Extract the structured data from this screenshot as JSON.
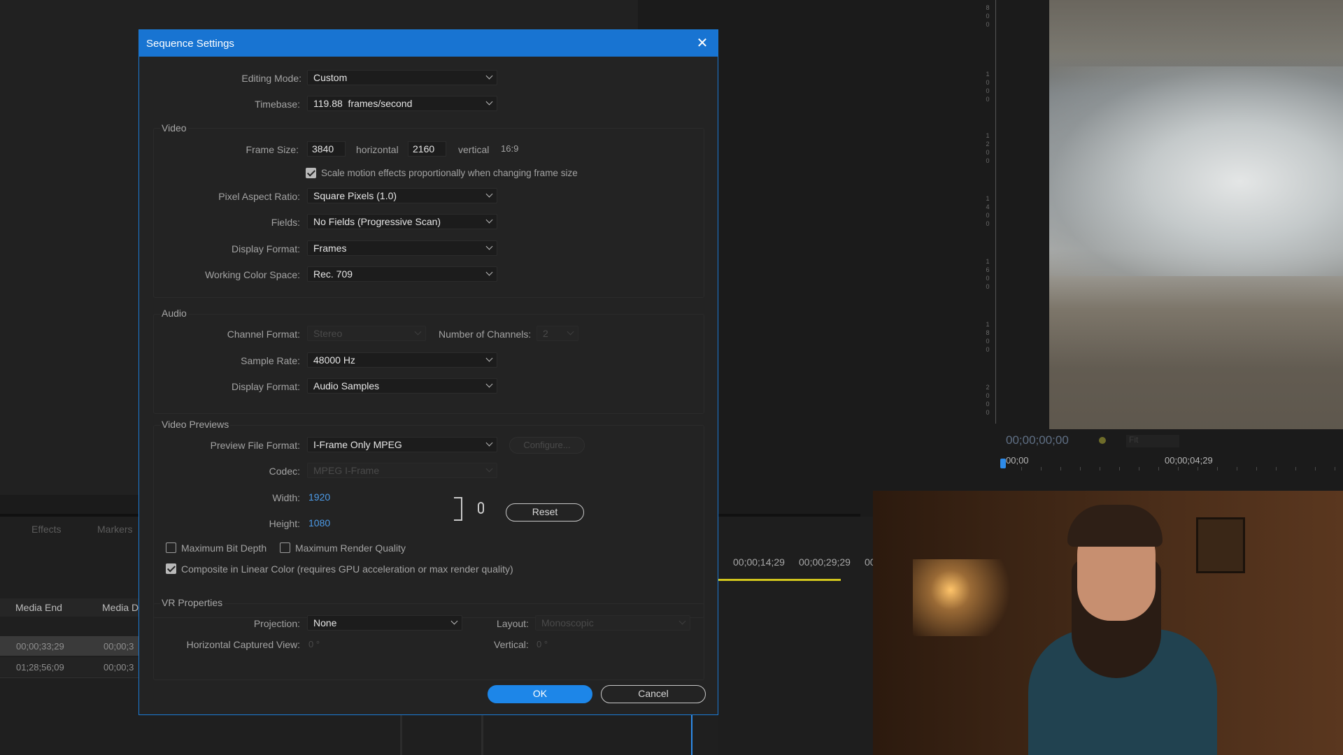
{
  "background": {
    "left_panel": {
      "tabs": [
        "Effects",
        "Markers"
      ],
      "columns": [
        "Media End",
        "Media D"
      ],
      "rows": [
        {
          "media_end": "00;00;33;29",
          "media_d": "00;00;3"
        },
        {
          "media_end": "01;28;56;09",
          "media_d": "00;00;3"
        }
      ]
    },
    "timeline": {
      "timecodes": [
        "00;00;14;29",
        "00;00;29;29",
        "00"
      ]
    },
    "program_monitor": {
      "timecode": "00;00;00;00",
      "fit_label": "Fit",
      "ruler_start": "00;00",
      "ruler_end": "00;00;04;29",
      "ruler_digits": [
        [
          "8",
          "0",
          "0"
        ],
        [
          "1",
          "0",
          "0",
          "0"
        ],
        [
          "1",
          "2",
          "0",
          "0"
        ],
        [
          "1",
          "4",
          "0",
          "0"
        ],
        [
          "1",
          "6",
          "0",
          "0"
        ],
        [
          "1",
          "8",
          "0",
          "0"
        ],
        [
          "2",
          "0",
          "0",
          "0"
        ]
      ]
    }
  },
  "dialog": {
    "title": "Sequence Settings",
    "close_icon": "close-icon",
    "editing_mode": {
      "label": "Editing Mode:",
      "value": "Custom"
    },
    "timebase": {
      "label": "Timebase:",
      "value": "119.88  frames/second"
    },
    "video": {
      "title": "Video",
      "frame_size_label": "Frame Size:",
      "width": "3840",
      "horizontal_label": "horizontal",
      "height": "2160",
      "vertical_label": "vertical",
      "aspect": "16:9",
      "scale_checkbox": {
        "label": "Scale motion effects proportionally when changing frame size",
        "checked": true
      },
      "pixel_aspect": {
        "label": "Pixel Aspect Ratio:",
        "value": "Square Pixels (1.0)"
      },
      "fields": {
        "label": "Fields:",
        "value": "No Fields (Progressive Scan)"
      },
      "display_format": {
        "label": "Display Format:",
        "value": "Frames"
      },
      "working_color_space": {
        "label": "Working Color Space:",
        "value": "Rec. 709"
      }
    },
    "audio": {
      "title": "Audio",
      "channel_format": {
        "label": "Channel Format:",
        "value": "Stereo"
      },
      "num_channels": {
        "label": "Number of Channels:",
        "value": "2"
      },
      "sample_rate": {
        "label": "Sample Rate:",
        "value": "48000 Hz"
      },
      "display_format": {
        "label": "Display Format:",
        "value": "Audio Samples"
      }
    },
    "video_previews": {
      "title": "Video Previews",
      "preview_file_format": {
        "label": "Preview File Format:",
        "value": "I-Frame Only MPEG"
      },
      "configure_label": "Configure...",
      "codec": {
        "label": "Codec:",
        "value": "MPEG I-Frame"
      },
      "width": {
        "label": "Width:",
        "value": "1920"
      },
      "height": {
        "label": "Height:",
        "value": "1080"
      },
      "reset_label": "Reset",
      "max_bit_depth": {
        "label": "Maximum Bit Depth",
        "checked": false
      },
      "max_render_quality": {
        "label": "Maximum Render Quality",
        "checked": false
      },
      "composite_linear": {
        "label": "Composite in Linear Color (requires GPU acceleration or max render quality)",
        "checked": true
      }
    },
    "vr": {
      "title": "VR Properties",
      "projection": {
        "label": "Projection:",
        "value": "None"
      },
      "layout": {
        "label": "Layout:",
        "value": "Monoscopic"
      },
      "horizontal_captured": {
        "label": "Horizontal Captured View:",
        "value": "0 °"
      },
      "vertical": {
        "label": "Vertical:",
        "value": "0 °"
      }
    },
    "ok_label": "OK",
    "cancel_label": "Cancel"
  }
}
